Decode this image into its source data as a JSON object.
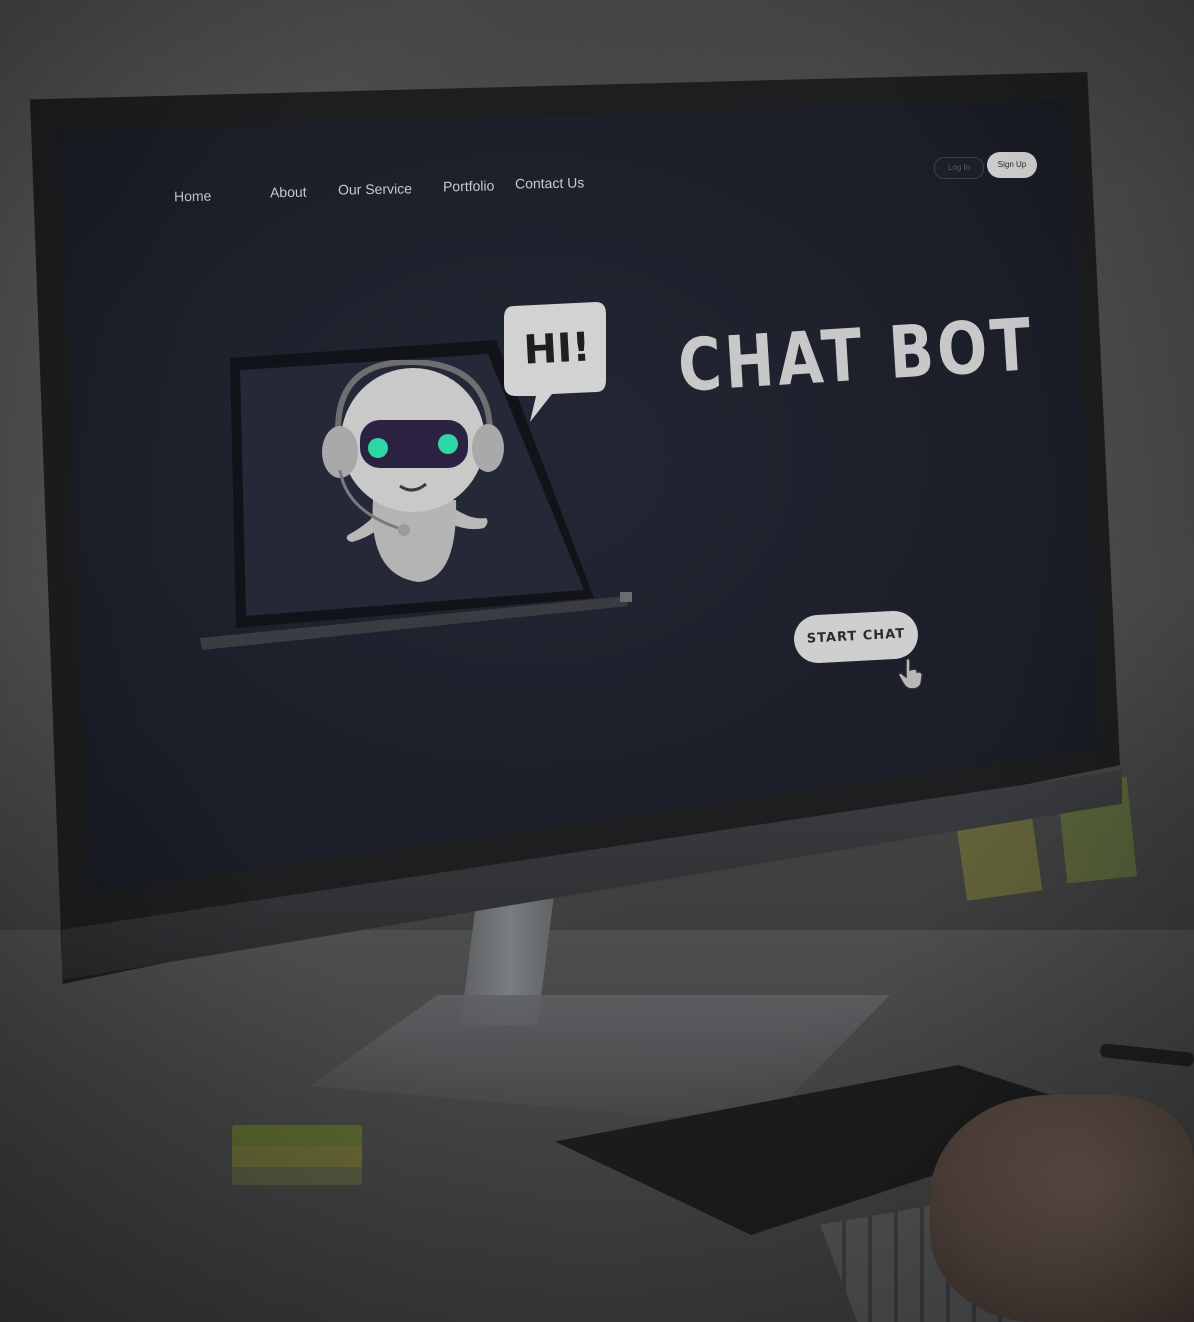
{
  "nav": {
    "items": [
      "Home",
      "About",
      "Our Service",
      "Portfolio",
      "Contact Us"
    ]
  },
  "auth": {
    "login_label": "Log In",
    "signup_label": "Sign Up"
  },
  "hero": {
    "title": "CHAT BOT",
    "speech_bubble": "HI!",
    "cta_label": "START CHAT"
  },
  "colors": {
    "screen_bg": "#1c1f29",
    "accent_eyes": "#2fd6a6",
    "robot_body": "#c9c9c9",
    "button_bg": "#cfcfcf"
  },
  "icons": {
    "cursor": "hand-pointer-icon"
  }
}
